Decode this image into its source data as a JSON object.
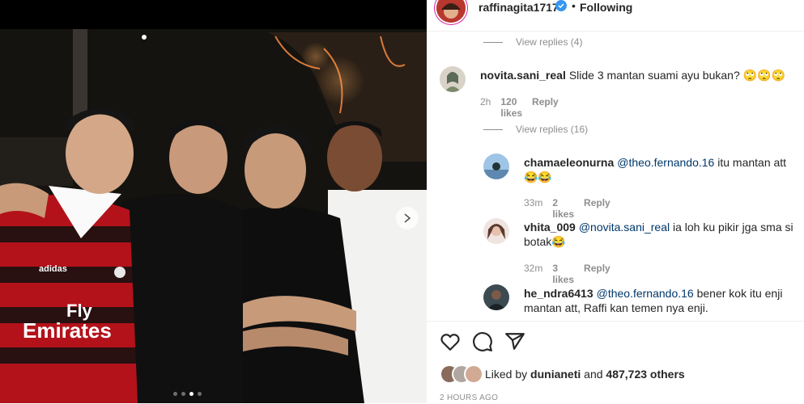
{
  "post": {
    "username": "raffinagita1717",
    "follow_dot": "•",
    "follow_status": "Following",
    "carousel_total": 4,
    "carousel_active": 3
  },
  "photo": {
    "jersey_text_line1": "Fly",
    "jersey_text_line2": "Emirates",
    "jersey_brand": "adidas"
  },
  "threads": [
    {
      "view_replies": "View replies (4)"
    },
    {
      "view_replies": "View replies (16)"
    }
  ],
  "comments": [
    {
      "user": "novita.sani_real",
      "text": "Slide 3 mantan suami ayu bukan? 🙄🙄🙄",
      "time": "2h",
      "likes": "120 likes",
      "reply": "Reply"
    },
    {
      "user": "chamaeleonurna",
      "mention": "@theo.fernando.16",
      "text": " itu mantan att😂😂",
      "time": "33m",
      "likes": "2 likes",
      "reply": "Reply"
    },
    {
      "user": "vhita_009",
      "mention": "@novita.sani_real",
      "text": " ia loh ku pikir jga sma si botak😂",
      "time": "32m",
      "likes": "3 likes",
      "reply": "Reply"
    },
    {
      "user": "he_ndra6413",
      "mention": "@theo.fernando.16",
      "text": " bener kok itu enji mantan att, Raffi kan temen nya enji."
    }
  ],
  "likes": {
    "prefix": "Liked by",
    "user": "dunianeti",
    "and": "and",
    "count": "487,723 others"
  },
  "timestamp": "2 HOURS AGO",
  "colors": {
    "accent": "#3897f0",
    "mention": "#00376b",
    "muted": "#8e8e8e"
  },
  "icons": [
    "heart-icon",
    "comment-icon",
    "share-icon",
    "verified-icon",
    "chevron-right-icon"
  ]
}
